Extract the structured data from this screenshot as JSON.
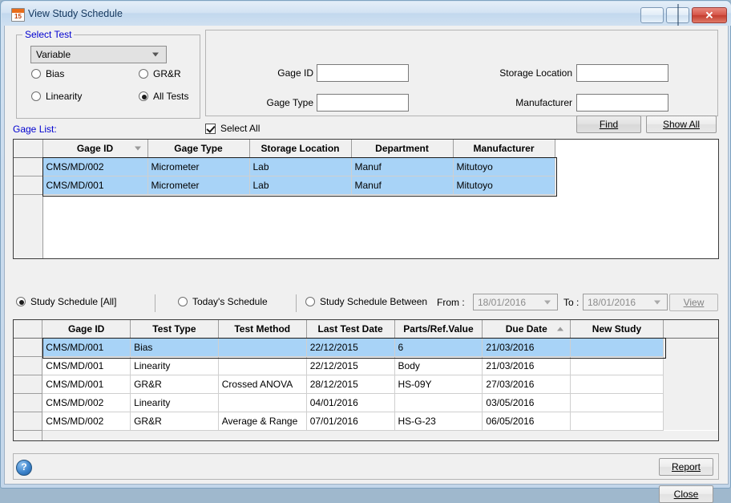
{
  "window": {
    "title": "View Study Schedule",
    "icon": "calendar-icon",
    "icon_day": "15",
    "minimize_label": "",
    "maximize_label": "",
    "close_label": "✕"
  },
  "select_test": {
    "legend": "Select Test",
    "combo_value": "Variable",
    "options": [
      "Variable"
    ],
    "radios": [
      {
        "label": "Bias",
        "checked": false
      },
      {
        "label": "GR&R",
        "checked": false
      },
      {
        "label": "Linearity",
        "checked": false
      },
      {
        "label": "All Tests",
        "checked": true
      }
    ]
  },
  "search": {
    "fields": [
      {
        "label": "Gage ID",
        "value": ""
      },
      {
        "label": "Gage Type",
        "value": ""
      },
      {
        "label": "Storage Location",
        "value": ""
      },
      {
        "label": "Manufacturer",
        "value": ""
      }
    ],
    "find_button": "Find",
    "show_all_button": "Show All"
  },
  "gage_list": {
    "label": "Gage List:",
    "select_all": {
      "label": "Select All",
      "checked": true
    },
    "columns": [
      "Gage ID",
      "Gage Type",
      "Storage Location",
      "Department",
      "Manufacturer"
    ],
    "sort_column": "Gage ID",
    "sort_direction": "desc",
    "rows": [
      {
        "selected": true,
        "cells": [
          "CMS/MD/002",
          "Micrometer",
          "Lab",
          "Manuf",
          "Mitutoyo"
        ]
      },
      {
        "selected": true,
        "cells": [
          "CMS/MD/001",
          "Micrometer",
          "Lab",
          "Manuf",
          "Mitutoyo"
        ]
      }
    ]
  },
  "schedule_filter": {
    "radios": [
      {
        "label": "Study Schedule [All]",
        "checked": true
      },
      {
        "label": "Today's  Schedule",
        "checked": false
      },
      {
        "label": "Study Schedule Between",
        "checked": false
      }
    ],
    "from_label": "From :",
    "from_value": "18/01/2016",
    "to_label": "To :",
    "to_value": "18/01/2016",
    "view_button": "View",
    "disabled": true
  },
  "schedule_grid": {
    "columns": [
      "Gage ID",
      "Test Type",
      "Test Method",
      "Last Test Date",
      "Parts/Ref.Value",
      "Due Date",
      "New Study"
    ],
    "sort_column": "Due Date",
    "sort_direction": "asc",
    "rows": [
      {
        "selected": true,
        "cells": [
          "CMS/MD/001",
          "Bias",
          "",
          "22/12/2015",
          "6",
          "21/03/2016",
          ""
        ]
      },
      {
        "selected": false,
        "cells": [
          "CMS/MD/001",
          "Linearity",
          "",
          "22/12/2015",
          "Body",
          "21/03/2016",
          ""
        ]
      },
      {
        "selected": false,
        "cells": [
          "CMS/MD/001",
          "GR&R",
          "Crossed ANOVA",
          "28/12/2015",
          "HS-09Y",
          "27/03/2016",
          ""
        ]
      },
      {
        "selected": false,
        "cells": [
          "CMS/MD/002",
          "Linearity",
          "",
          "04/01/2016",
          "",
          "03/05/2016",
          ""
        ]
      },
      {
        "selected": false,
        "cells": [
          "CMS/MD/002",
          "GR&R",
          "Average & Range",
          "07/01/2016",
          "HS-G-23",
          "06/05/2016",
          ""
        ]
      }
    ]
  },
  "footer": {
    "help_icon": "help-icon",
    "help_glyph": "?",
    "report_button": "Report",
    "close_button": "Close"
  },
  "colors": {
    "selection": "#a8d3f7",
    "link_text": "#0000d0",
    "window_border": "#7ea2c0",
    "close_button": "#c33d2f"
  }
}
